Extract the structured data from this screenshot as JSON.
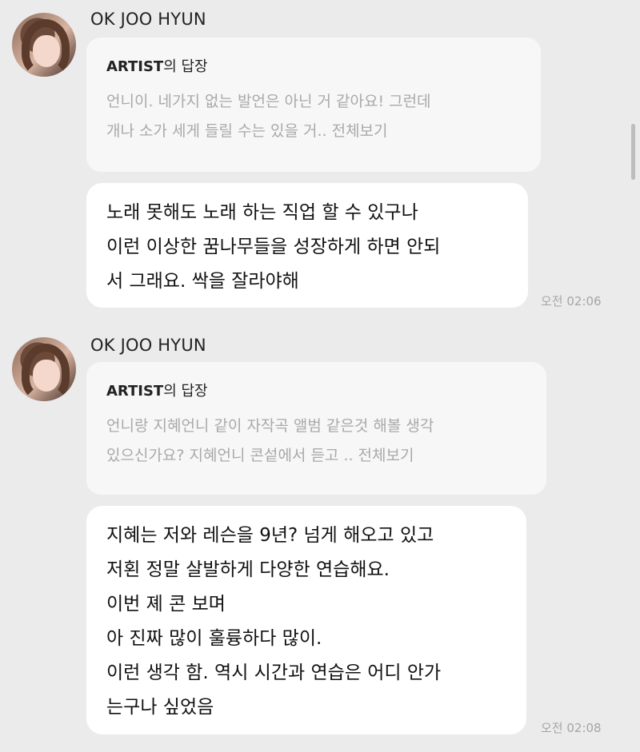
{
  "messages": [
    {
      "sender": "OK JOO HYUN",
      "reply_title": "ARTIST",
      "reply_suffix": "의 답장",
      "reply_text": "언니이. 네가지 없는 발언은 아닌 거 같아요! 그런데\n개나 소가 세게 들릴 수는 있을 거.. 전체보기",
      "body": "노래 못해도 노래 하는 직업 할 수 있구나\n이런 이상한 꿈나무들을 성장하게 하면 안되\n서 그래요. 싹을 잘라야해",
      "time": "오전 02:06"
    },
    {
      "sender": "OK JOO HYUN",
      "reply_title": "ARTIST",
      "reply_suffix": "의 답장",
      "reply_text": "언니랑 지혜언니 같이 자작곡 앨범 같은것 해볼 생각\n있으신가요? 지혜언니 콘섵에서 듣고 .. 전체보기",
      "body": "지혜는 저와 레슨을 9년? 넘게 해오고 있고\n저횐 정말 살발하게 다양한 연습해요.\n이번 졔 콘 보며\n아 진짜 많이 훌륭하다   많이.\n이런 생각 함. 역시 시간과 연습은 어디 안가\n는구나 싶었음",
      "time": "오전 02:08"
    }
  ]
}
